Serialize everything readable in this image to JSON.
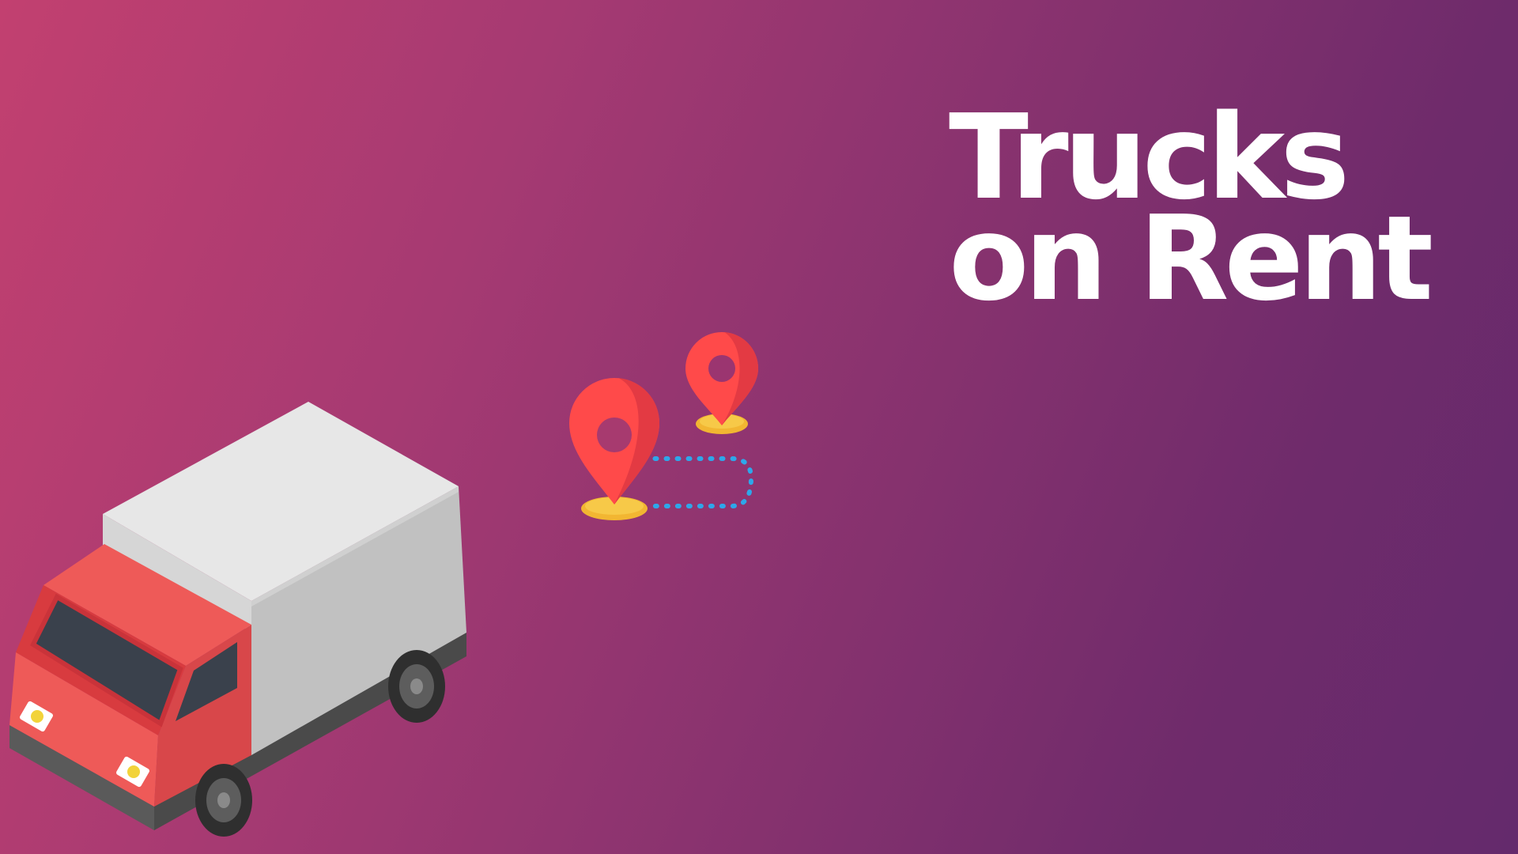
{
  "hero": {
    "title_line1": "Trucks",
    "title_line2": "on Rent"
  },
  "illustrations": {
    "truck": "delivery-truck-icon",
    "route": "route-pins-icon"
  },
  "colors": {
    "gradient_start": "#c24070",
    "gradient_end": "#642a6c",
    "title": "#ffffff",
    "pin_red": "#ff4a4a",
    "pin_base": "#f7c948",
    "route_dots": "#2ea7ea",
    "truck_cab": "#ee5a58",
    "truck_box": "#e6e6e6"
  }
}
